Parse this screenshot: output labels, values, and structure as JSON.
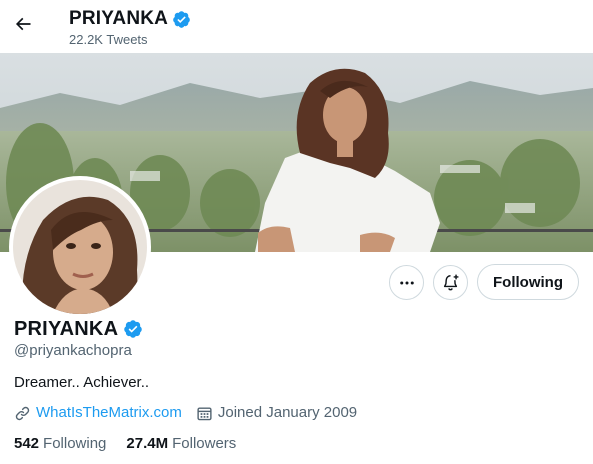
{
  "header": {
    "title": "PRIYANKA",
    "tweet_count": "22.2K Tweets"
  },
  "profile": {
    "name": "PRIYANKA",
    "handle": "@priyankachopra",
    "bio": "Dreamer.. Achiever..",
    "website": "WhatIsTheMatrix.com",
    "joined": "Joined January 2009",
    "following_count": "542",
    "following_label": "Following",
    "followers_count": "27.4M",
    "followers_label": "Followers"
  },
  "actions": {
    "following_button": "Following"
  },
  "icons": {
    "back": "arrow-left-icon",
    "verified": "verified-badge-icon",
    "more": "more-dots-icon",
    "notify": "bell-plus-icon",
    "link": "link-icon",
    "calendar": "calendar-icon"
  },
  "colors": {
    "accent": "#1d9bf0",
    "text_primary": "#0f1419",
    "text_secondary": "#536471",
    "border": "#cfd9de"
  }
}
